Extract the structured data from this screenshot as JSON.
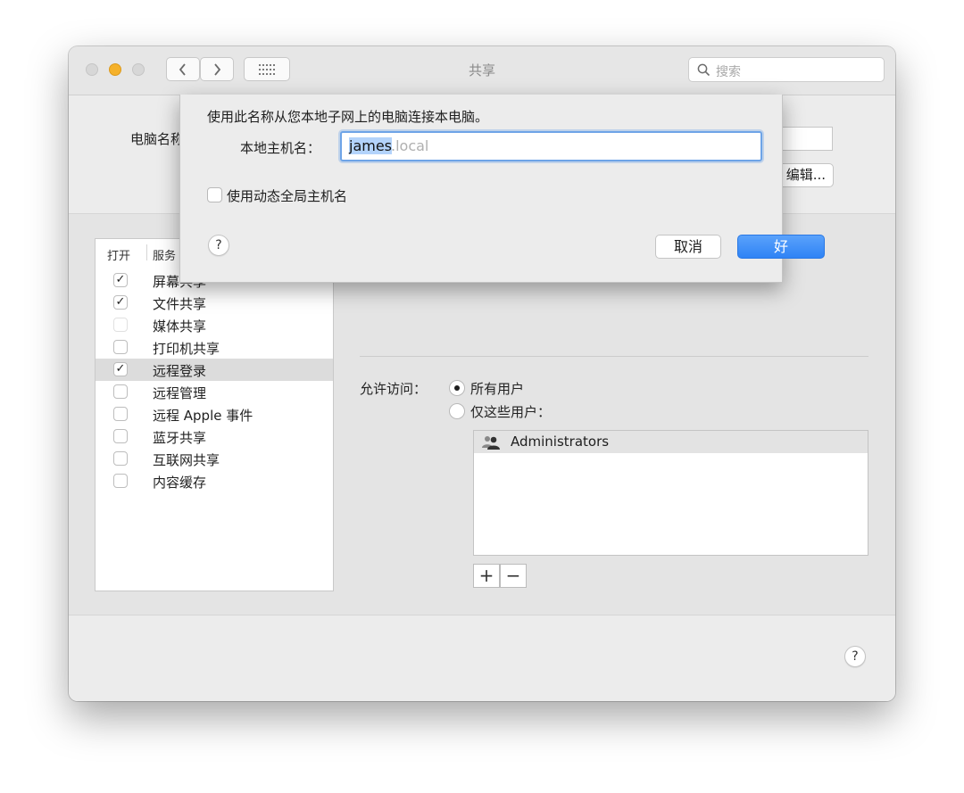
{
  "window": {
    "title": "共享",
    "search_placeholder": "搜索"
  },
  "upper": {
    "computer_name_label": "电脑名称：",
    "edit_button": "编辑..."
  },
  "services": {
    "header_on": "打开",
    "header_service": "服务",
    "items": [
      {
        "label": "屏幕共享",
        "checked": true
      },
      {
        "label": "文件共享",
        "checked": true
      },
      {
        "label": "媒体共享",
        "checked": false
      },
      {
        "label": "打印机共享",
        "checked": false
      },
      {
        "label": "远程登录",
        "checked": true
      },
      {
        "label": "远程管理",
        "checked": false
      },
      {
        "label": "远程 Apple 事件",
        "checked": false
      },
      {
        "label": "蓝牙共享",
        "checked": false
      },
      {
        "label": "互联网共享",
        "checked": false
      },
      {
        "label": "内容缓存",
        "checked": false
      }
    ]
  },
  "access": {
    "label": "允许访问：",
    "option_all": "所有用户",
    "option_only": "仅这些用户：",
    "users": [
      "Administrators"
    ],
    "add": "+",
    "remove": "−"
  },
  "sheet": {
    "description": "使用此名称从您本地子网上的电脑连接本电脑。",
    "hostname_label": "本地主机名：",
    "hostname_value": "james",
    "hostname_suffix": ".local",
    "dynamic_checkbox_label": "使用动态全局主机名",
    "help": "?",
    "cancel": "取消",
    "ok": "好"
  },
  "help": "?",
  "colors": {
    "accent": "#3a8cf8",
    "selection": "#b3d3fb"
  }
}
